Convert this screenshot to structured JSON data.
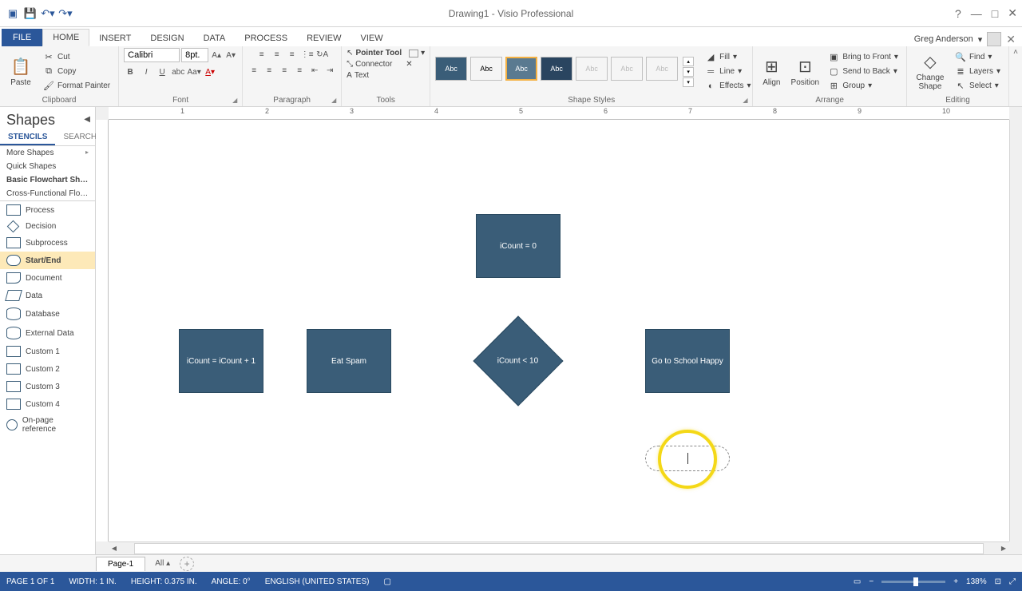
{
  "title": "Drawing1 - Visio Professional",
  "user": "Greg Anderson",
  "ribbon": {
    "tabs": [
      "FILE",
      "HOME",
      "INSERT",
      "DESIGN",
      "DATA",
      "PROCESS",
      "REVIEW",
      "VIEW"
    ],
    "active_tab": "HOME",
    "clipboard": {
      "label": "Clipboard",
      "paste": "Paste",
      "cut": "Cut",
      "copy": "Copy",
      "format_painter": "Format Painter"
    },
    "font": {
      "label": "Font",
      "name": "Calibri",
      "size": "8pt."
    },
    "paragraph": {
      "label": "Paragraph"
    },
    "tools": {
      "label": "Tools",
      "pointer": "Pointer Tool",
      "connector": "Connector",
      "text": "Text"
    },
    "shape_styles": {
      "label": "Shape Styles",
      "swatch": "Abc",
      "fill": "Fill",
      "line": "Line",
      "effects": "Effects"
    },
    "arrange": {
      "label": "Arrange",
      "align": "Align",
      "position": "Position",
      "bring_front": "Bring to Front",
      "send_back": "Send to Back",
      "group": "Group"
    },
    "editing": {
      "label": "Editing",
      "change_shape": "Change Shape",
      "find": "Find",
      "layers": "Layers",
      "select": "Select"
    }
  },
  "shapes_panel": {
    "title": "Shapes",
    "tabs": {
      "stencils": "STENCILS",
      "search": "SEARCH"
    },
    "stencils": [
      "More Shapes",
      "Quick Shapes",
      "Basic Flowchart Shapes",
      "Cross-Functional Flow…"
    ],
    "shapes": [
      "Process",
      "Decision",
      "Subprocess",
      "Start/End",
      "Document",
      "Data",
      "Database",
      "External Data",
      "Custom 1",
      "Custom 2",
      "Custom 3",
      "Custom 4",
      "On-page reference"
    ],
    "selected_shape": "Start/End"
  },
  "canvas": {
    "ruler_marks": [
      "1",
      "2",
      "3",
      "4",
      "5",
      "6",
      "7",
      "8",
      "9",
      "10"
    ],
    "shapes": {
      "top_block": "",
      "init": "iCount = 0",
      "increment": "iCount = iCount + 1",
      "eat": "Eat Spam",
      "condition": "iCount < 10",
      "happy": "Go to School Happy"
    }
  },
  "page_tabs": {
    "page1": "Page-1",
    "all": "All"
  },
  "status": {
    "page": "PAGE 1 OF 1",
    "width": "WIDTH: 1 IN.",
    "height": "HEIGHT: 0.375 IN.",
    "angle": "ANGLE: 0°",
    "lang": "ENGLISH (UNITED STATES)",
    "zoom": "138%"
  }
}
